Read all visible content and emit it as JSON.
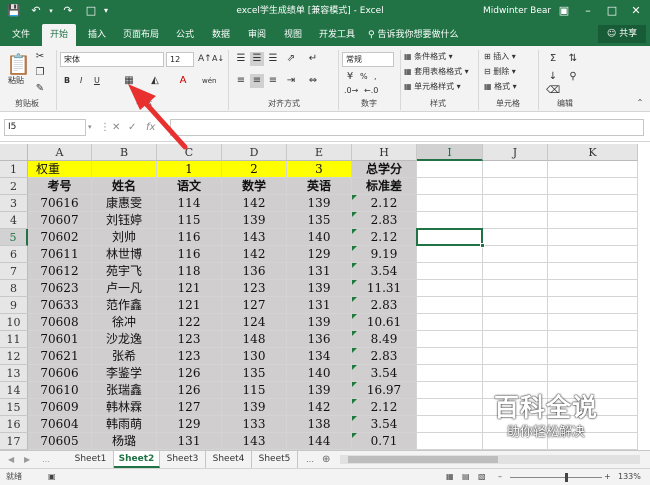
{
  "window": {
    "title": "excel学生成绩单 [兼容模式] - Excel",
    "user": "Midwinter Bear",
    "qa_icons": [
      "save-icon",
      "undo-icon",
      "redo-icon",
      "new-file-icon",
      "customize-icon"
    ],
    "controls": [
      "ribbon-display-icon",
      "minimize-icon",
      "maximize-icon",
      "close-icon"
    ]
  },
  "tabs": [
    "文件",
    "开始",
    "插入",
    "页面布局",
    "公式",
    "数据",
    "审阅",
    "视图",
    "开发工具"
  ],
  "active_tab": "开始",
  "tell_me": "告诉我你想要做什么",
  "share": "共享",
  "ribbon": {
    "clipboard": {
      "label": "剪贴板",
      "paste": "粘贴"
    },
    "font": {
      "label": "字体",
      "name": "宋体",
      "size": "12",
      "bold": "B",
      "italic": "I",
      "underline": "U",
      "wen": "wén"
    },
    "alignment": {
      "label": "对齐方式"
    },
    "number": {
      "label": "数字",
      "format": "常规",
      "percent": "%",
      "comma": ","
    },
    "styles": {
      "label": "样式",
      "items": [
        "条件格式",
        "套用表格格式",
        "单元格样式"
      ]
    },
    "cells": {
      "label": "单元格",
      "items": [
        "插入",
        "删除",
        "格式"
      ]
    },
    "editing": {
      "label": "编辑"
    }
  },
  "formula_bar": {
    "name_box": "I5",
    "value": ""
  },
  "columns": [
    "A",
    "B",
    "C",
    "D",
    "E",
    "H",
    "I",
    "J",
    "K"
  ],
  "selected_column": "I",
  "selected_row": "5",
  "rows": [
    {
      "num": "1",
      "cells": [
        "权重",
        "",
        "1",
        "2",
        "3",
        "总学分"
      ]
    },
    {
      "num": "2",
      "cells": [
        "考号",
        "姓名",
        "语文",
        "数学",
        "英语",
        "标准差"
      ]
    },
    {
      "num": "3",
      "cells": [
        "70616",
        "康惠雯",
        "114",
        "142",
        "139",
        "2.12"
      ]
    },
    {
      "num": "4",
      "cells": [
        "70607",
        "刘钰婷",
        "115",
        "139",
        "135",
        "2.83"
      ]
    },
    {
      "num": "5",
      "cells": [
        "70602",
        "刘帅",
        "116",
        "143",
        "140",
        "2.12"
      ]
    },
    {
      "num": "6",
      "cells": [
        "70611",
        "林世博",
        "116",
        "142",
        "129",
        "9.19"
      ]
    },
    {
      "num": "7",
      "cells": [
        "70612",
        "苑宇飞",
        "118",
        "136",
        "131",
        "3.54"
      ]
    },
    {
      "num": "8",
      "cells": [
        "70623",
        "卢一凡",
        "121",
        "123",
        "139",
        "11.31"
      ]
    },
    {
      "num": "9",
      "cells": [
        "70633",
        "范作鑫",
        "121",
        "127",
        "131",
        "2.83"
      ]
    },
    {
      "num": "10",
      "cells": [
        "70608",
        "徐冲",
        "122",
        "124",
        "139",
        "10.61"
      ]
    },
    {
      "num": "11",
      "cells": [
        "70601",
        "沙龙逸",
        "123",
        "148",
        "136",
        "8.49"
      ]
    },
    {
      "num": "12",
      "cells": [
        "70621",
        "张希",
        "123",
        "130",
        "134",
        "2.83"
      ]
    },
    {
      "num": "13",
      "cells": [
        "70606",
        "李鉴学",
        "126",
        "135",
        "140",
        "3.54"
      ]
    },
    {
      "num": "14",
      "cells": [
        "70610",
        "张瑞鑫",
        "126",
        "115",
        "139",
        "16.97"
      ]
    },
    {
      "num": "15",
      "cells": [
        "70609",
        "韩林霖",
        "127",
        "139",
        "142",
        "2.12"
      ]
    },
    {
      "num": "16",
      "cells": [
        "70604",
        "韩雨萌",
        "129",
        "133",
        "138",
        "3.54"
      ]
    },
    {
      "num": "17",
      "cells": [
        "70605",
        "杨璐",
        "131",
        "143",
        "144",
        "0.71"
      ]
    }
  ],
  "sheets": [
    "Sheet1",
    "Sheet2",
    "Sheet3",
    "Sheet4",
    "Sheet5"
  ],
  "active_sheet": "Sheet2",
  "status": {
    "ready": "就绪",
    "zoom": "133%"
  },
  "watermark": {
    "logo": "百科全说",
    "slogan": "助你轻松解决"
  },
  "colors": {
    "excel_green": "#217346",
    "header_yellow": "#ffff00",
    "data_gray": "#d0cece",
    "arrow_red": "#e8312f"
  }
}
